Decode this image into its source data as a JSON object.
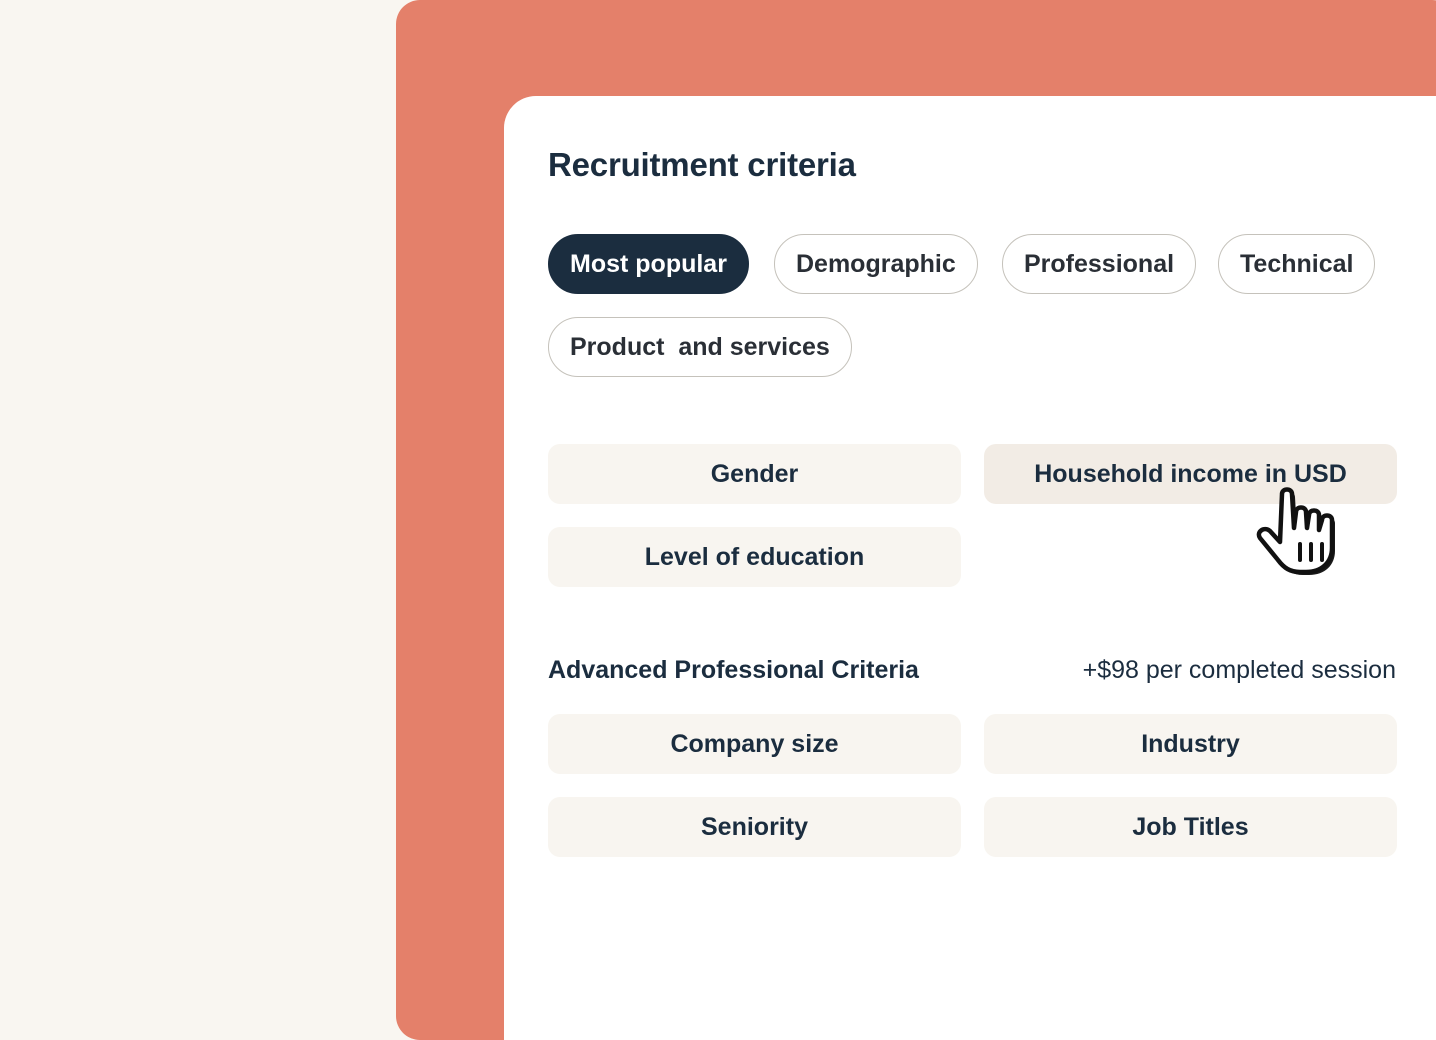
{
  "panel": {
    "title": "Recruitment criteria"
  },
  "categories": [
    {
      "label": "Most popular",
      "active": true
    },
    {
      "label": "Demographic",
      "active": false
    },
    {
      "label": "Professional",
      "active": false
    },
    {
      "label": "Technical",
      "active": false
    },
    {
      "label": "Product  and services",
      "active": false
    }
  ],
  "criteria": [
    {
      "label": "Gender"
    },
    {
      "label": "Household income in USD",
      "hovered": true
    },
    {
      "label": "Level of education"
    }
  ],
  "advanced": {
    "title": "Advanced Professional Criteria",
    "price_note": "+$98 per completed session",
    "items": [
      {
        "label": "Company size"
      },
      {
        "label": "Industry"
      },
      {
        "label": "Seniority"
      },
      {
        "label": "Job Titles"
      }
    ]
  },
  "colors": {
    "accent": "#e4806a",
    "page_background": "#f9f6f1",
    "active_pill": "#1b2d3f",
    "tile_background": "#f8f5f0",
    "text": "#1b2d3f"
  },
  "icons": {
    "cursor": "hand-pointer-icon"
  }
}
